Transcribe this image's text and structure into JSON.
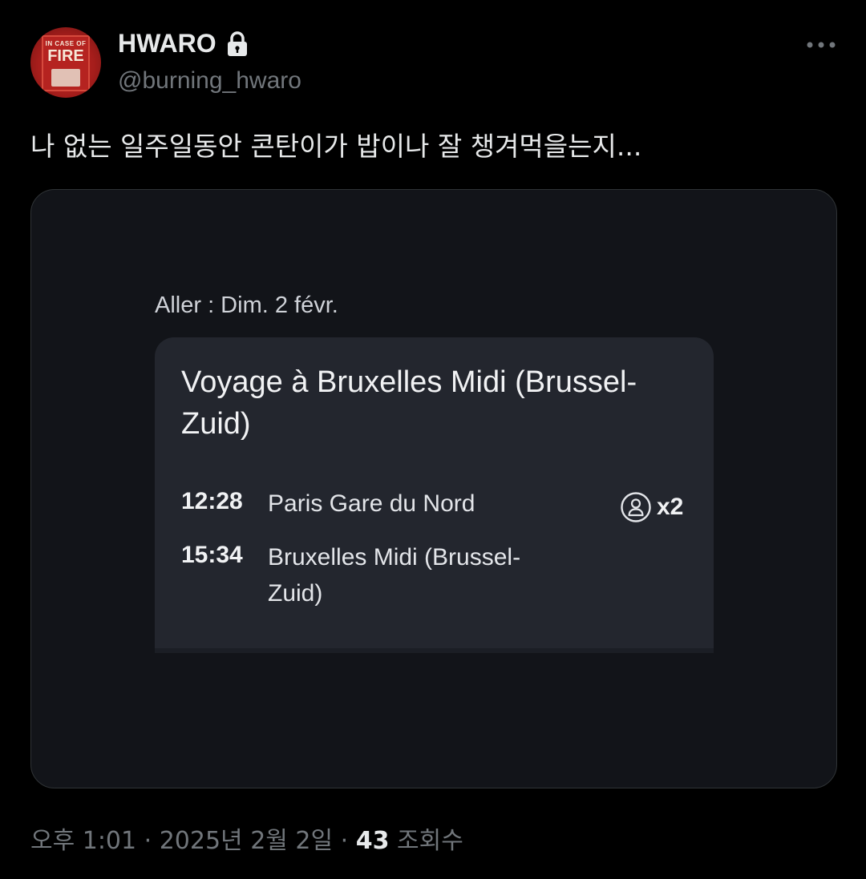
{
  "author": {
    "display_name": "HWARO",
    "handle": "@burning_hwaro",
    "avatar_text_top": "IN CASE OF",
    "avatar_text_main": "FIRE"
  },
  "tweet": {
    "text": "나 없는 일주일동안 콘탄이가 밥이나 잘 챙겨먹을는지..."
  },
  "media": {
    "aller_label": "Aller : Dim. 2 févr.",
    "trip_title": "Voyage à Bruxelles Midi (Brussel-Zuid)",
    "departure": {
      "time": "12:28",
      "station": "Paris Gare du Nord"
    },
    "arrival": {
      "time": "15:34",
      "station": "Bruxelles Midi (Brussel-Zuid)"
    },
    "passengers": "x2"
  },
  "meta": {
    "timestamp": "오후 1:01 · 2025년 2월 2일 · ",
    "views_count": "43",
    "views_label": " 조회수"
  },
  "colors": {
    "background": "#000000",
    "text_primary": "#e7e9ea",
    "text_secondary": "#71767b",
    "media_bg": "#121419",
    "card_bg": "#23262e"
  },
  "icons": {
    "lock": "lock-icon",
    "more": "more-icon",
    "person": "person-icon"
  }
}
